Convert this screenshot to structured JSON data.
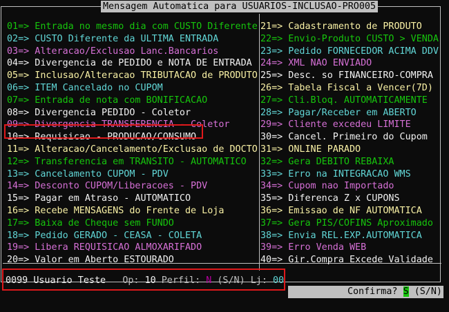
{
  "window": {
    "title": "Mensagem Automatica para USUARIOS-INCLUSAO-PRO005"
  },
  "colors": {
    "white": "#f2f2f2",
    "yellow": "#f9f1a5",
    "cyan": "#61d6d6",
    "green": "#16c60c",
    "magenta": "#d670d6",
    "highlight_border": "#e0191b",
    "frame": "#c0c0c0",
    "background": "#0c0c0c"
  },
  "left_items": [
    {
      "code": "01=>",
      "text": " Entrada no mesmo dia com CUSTO Diferente",
      "color": "green"
    },
    {
      "code": "02=>",
      "text": " CUSTO Diferente da ULTIMA ENTRADA",
      "color": "cyan"
    },
    {
      "code": "03=>",
      "text": " Alteracao/Exclusao Lanc.Bancarios",
      "color": "magenta"
    },
    {
      "code": "04=>",
      "text": " Divergencia de PEDIDO e NOTA DE ENTRADA",
      "color": "white"
    },
    {
      "code": "05=>",
      "text": " Inclusao/Alteracao TRIBUTACAO de PRODUTO",
      "color": "yellow"
    },
    {
      "code": "06=>",
      "text": " ITEM Cancelado no CUPOM",
      "color": "cyan"
    },
    {
      "code": "07=>",
      "text": " Entrada de nota com BONIFICACAO",
      "color": "green"
    },
    {
      "code": "08=>",
      "text": " Divergencia PEDIDO - Coletor",
      "color": "white"
    },
    {
      "code": "09=>",
      "text": " Divergencia TRANSFERENCIA - Coletor",
      "color": "magenta"
    },
    {
      "code": "10=>",
      "text": " Requisicao - PRODUCAO/CONSUMO",
      "color": "white"
    },
    {
      "code": "11=>",
      "text": " Alteracao/Cancelamento/Exclusao de DOCTO",
      "color": "yellow"
    },
    {
      "code": "12=>",
      "text": " Transferencia em TRANSITO - AUTOMATICO",
      "color": "green"
    },
    {
      "code": "13=>",
      "text": " Cancelamento CUPOM - PDV",
      "color": "cyan"
    },
    {
      "code": "14=>",
      "text": " Desconto CUPOM/Liberacoes - PDV",
      "color": "magenta"
    },
    {
      "code": "15=>",
      "text": " Pagar em Atraso - AUTOMATICO",
      "color": "white"
    },
    {
      "code": "16=>",
      "text": " Recebe MENSAGENS do Frente de Loja",
      "color": "yellow"
    },
    {
      "code": "17=>",
      "text": " Baixa de Cheque sem FUNDO",
      "color": "green"
    },
    {
      "code": "18=>",
      "text": " Pedido GERADO - CEASA - COLETA",
      "color": "cyan"
    },
    {
      "code": "19=>",
      "text": " Libera REQUISICAO ALMOXARIFADO",
      "color": "magenta"
    },
    {
      "code": "20=>",
      "text": " Valor em Aberto ESTOURADO",
      "color": "white"
    }
  ],
  "right_items": [
    {
      "code": "21=>",
      "text": " Cadastramento de PRODUTO",
      "color": "yellow"
    },
    {
      "code": "22=>",
      "text": " Envio-Produto CUSTO > VENDA",
      "color": "green"
    },
    {
      "code": "23=>",
      "text": " Pedido FORNECEDOR ACIMA DDV",
      "color": "cyan"
    },
    {
      "code": "24=>",
      "text": " XML NAO ENVIADO",
      "color": "magenta"
    },
    {
      "code": "25=>",
      "text": " Desc. so FINANCEIRO-COMPRA",
      "color": "white"
    },
    {
      "code": "26=>",
      "text": " Tabela Fiscal a Vencer(7D)",
      "color": "yellow"
    },
    {
      "code": "27=>",
      "text": " Cli.Bloq. AUTOMATICAMENTE",
      "color": "green"
    },
    {
      "code": "28=>",
      "text": " Pagar/Receber em ABERTO",
      "color": "cyan"
    },
    {
      "code": "29=>",
      "text": " Cliente excedeu LIMITE",
      "color": "magenta"
    },
    {
      "code": "30=>",
      "text": " Cancel. Primeiro do Cupom",
      "color": "white"
    },
    {
      "code": "31=>",
      "text": " ONLINE PARADO",
      "color": "yellow"
    },
    {
      "code": "32=>",
      "text": " Gera DEBITO REBAIXA",
      "color": "green"
    },
    {
      "code": "33=>",
      "text": " Erro na INTEGRACAO WMS",
      "color": "cyan"
    },
    {
      "code": "34=>",
      "text": " Cupom nao Importado",
      "color": "magenta"
    },
    {
      "code": "35=>",
      "text": " Diferenca Z x CUPONS",
      "color": "white"
    },
    {
      "code": "36=>",
      "text": " Emissao de NF AUTOMATICA",
      "color": "yellow"
    },
    {
      "code": "37=>",
      "text": " Gera PIS/COFINS Aproximado",
      "color": "green"
    },
    {
      "code": "38=>",
      "text": " Envia REL.EXP.AUTOMATICA",
      "color": "cyan"
    },
    {
      "code": "39=>",
      "text": " Erro Venda WEB",
      "color": "magenta"
    },
    {
      "code": "40=>",
      "text": " Gir.Compra Excede Validade",
      "color": "white"
    }
  ],
  "user": {
    "code": "0099",
    "name": "Usuario Teste",
    "op_label": "Op:",
    "op_value": "10",
    "perfil_label": "Perfil:",
    "perfil_value": "N",
    "perfil_options": "(S/N)",
    "lj_label": "Lj:",
    "lj_value": "00"
  },
  "confirm": {
    "label": "Confirma?",
    "value": "S",
    "options": "(S/N)"
  }
}
